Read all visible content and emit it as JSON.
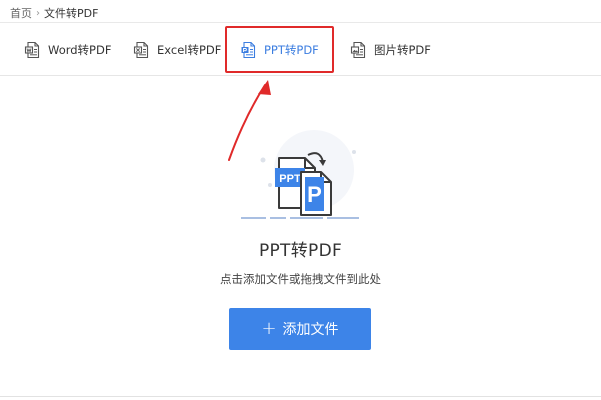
{
  "breadcrumb": {
    "home": "首页",
    "separator": "›",
    "current": "文件转PDF"
  },
  "tabs": [
    {
      "label": "Word转PDF",
      "icon": "word-doc-icon"
    },
    {
      "label": "Excel转PDF",
      "icon": "excel-doc-icon"
    },
    {
      "label": "PPT转PDF",
      "icon": "ppt-doc-icon",
      "active": true
    },
    {
      "label": "图片转PDF",
      "icon": "image-doc-icon"
    }
  ],
  "annotation": {
    "color": "#e02a2a",
    "target": "tab-ppt-to-pdf"
  },
  "illustration": {
    "badge_text": "PPT",
    "pdf_letter": "P"
  },
  "main": {
    "title": "PPT转PDF",
    "hint": "点击添加文件或拖拽文件到此处",
    "add_button": {
      "icon": "+",
      "label": "添加文件"
    }
  },
  "colors": {
    "accent": "#3d84e8",
    "active_tab": "#3c7ee0",
    "highlight": "#e02a2a"
  }
}
